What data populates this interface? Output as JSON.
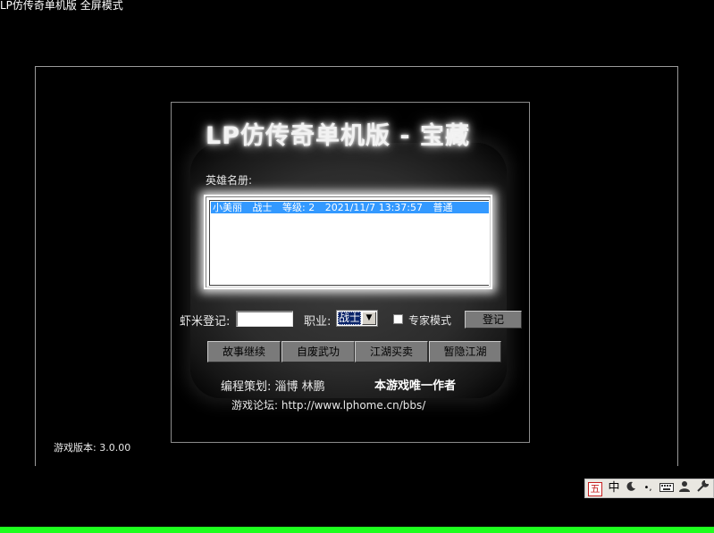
{
  "window": {
    "title": "LP仿传奇单机版 全屏模式"
  },
  "game": {
    "title": "LP仿传奇单机版 - 宝藏"
  },
  "hero_list": {
    "label": "英雄名册:",
    "rows": [
      {
        "name": "小美丽",
        "job": "战士",
        "level": "等级: 2",
        "datetime": "2021/11/7 13:37:57",
        "mode": "普通"
      }
    ]
  },
  "form": {
    "name_label": "虾米登记:",
    "name_value": "",
    "job_label": "职业:",
    "job_selected": "战士",
    "expert_label": "专家模式",
    "expert_checked": false,
    "login_button": "登记"
  },
  "actions": [
    "故事继续",
    "自废武功",
    "江湖买卖",
    "暂隐江湖"
  ],
  "credits": {
    "producer": "编程策划: 淄博 林鹏",
    "sole_author": "本游戏唯一作者",
    "forum": "游戏论坛: http://www.lphome.cn/bbs/"
  },
  "version": "游戏版本: 3.0.00",
  "taskbar": {
    "ime": "五",
    "lang": "中",
    "icons": [
      "moon-icon",
      "punctuation-icon",
      "keyboard-icon",
      "user-icon",
      "wrench-icon"
    ]
  },
  "colors": {
    "selection": "#3399ff",
    "accent_green": "#1eff1e",
    "button_gray": "#7a7a7a"
  }
}
